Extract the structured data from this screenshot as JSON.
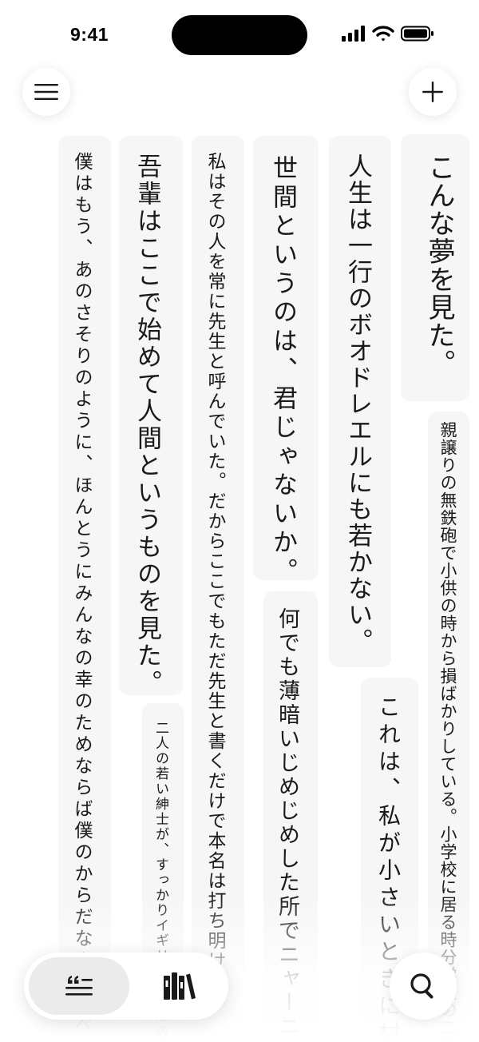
{
  "status_bar": {
    "time": "9:41"
  },
  "quotes": [
    {
      "id": "q1",
      "text": "こんな夢を見た。"
    },
    {
      "id": "q2",
      "text": "親譲りの無鉄砲で小供の時から損ばかりしている。小学校に居る時分学校の二階から"
    },
    {
      "id": "q3",
      "text": "人生は一行のボオドレエルにも若かない。"
    },
    {
      "id": "q4",
      "text": "これは、私が小さいときに村の"
    },
    {
      "id": "q5",
      "text": "世間というのは、君じゃないか。"
    },
    {
      "id": "q6",
      "text": "何でも薄暗いじめじめした所でニャーニャー"
    },
    {
      "id": "q7",
      "text": "私はその人を常に先生と呼んでいた。だからここでもただ先生と書くだけで本名は打ち明けない"
    },
    {
      "id": "q8",
      "text": "吾輩はここで始めて人間というものを見た。"
    },
    {
      "id": "q9",
      "text": "二人の若い紳士が、すっかりイギリスの兵隊の"
    },
    {
      "id": "q10",
      "text": "僕はもう、あのさそりのように、ほんとうにみんなの幸のためならば僕のからだなんか百ぺん"
    }
  ]
}
